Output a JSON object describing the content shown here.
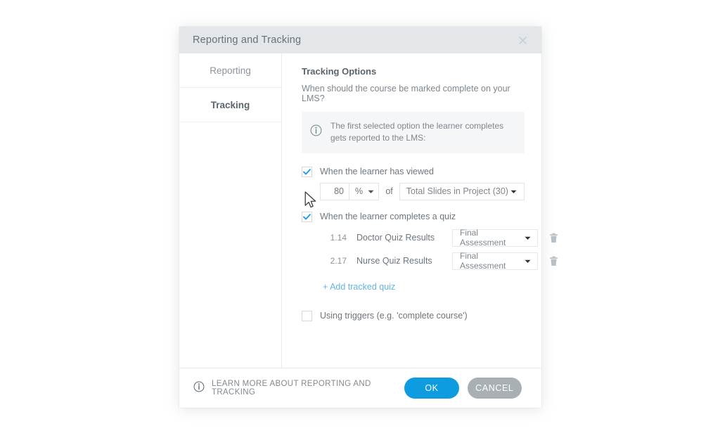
{
  "dialog": {
    "title": "Reporting and Tracking",
    "close_icon": "close-icon"
  },
  "sidebar": {
    "items": [
      {
        "label": "Reporting",
        "active": false
      },
      {
        "label": "Tracking",
        "active": true
      }
    ]
  },
  "content": {
    "section_title": "Tracking Options",
    "section_subtitle": "When should the course be marked complete on your LMS?",
    "info_panel": {
      "icon": "info-circle-icon",
      "text": "The first selected option the learner completes gets reported to the LMS:"
    },
    "viewed_option": {
      "checked": true,
      "label": "When the learner has viewed",
      "percent_value": "80",
      "percent_placeholder": "0",
      "unit_value": "%",
      "of_label": "of",
      "scope_value": "Total Slides in Project (30)"
    },
    "quiz_option": {
      "checked": true,
      "label": "When the learner completes a quiz",
      "rows": [
        {
          "number": "1.14",
          "name": "Doctor Quiz Results",
          "result_value": "Final Assessment",
          "delete_icon": "trash-icon"
        },
        {
          "number": "2.17",
          "name": "Nurse Quiz Results",
          "result_value": "Final Assessment",
          "delete_icon": "trash-icon"
        }
      ],
      "add_link": "+ Add tracked quiz"
    },
    "triggers_option": {
      "checked": false,
      "label": "Using triggers (e.g. 'complete course')"
    }
  },
  "footer": {
    "learn_more_icon": "info-circle-icon",
    "learn_more": "LEARN MORE ABOUT REPORTING AND TRACKING",
    "ok_label": "OK",
    "cancel_label": "CANCEL"
  },
  "colors": {
    "accent_blue": "#0e9ce0",
    "link_blue": "#64b3e4",
    "cancel_gray": "#a9b0b4",
    "titlebar": "#e3e7ea",
    "info_panel_bg": "#f4f6f7"
  },
  "cursor": {
    "icon": "mouse-pointer-icon"
  }
}
